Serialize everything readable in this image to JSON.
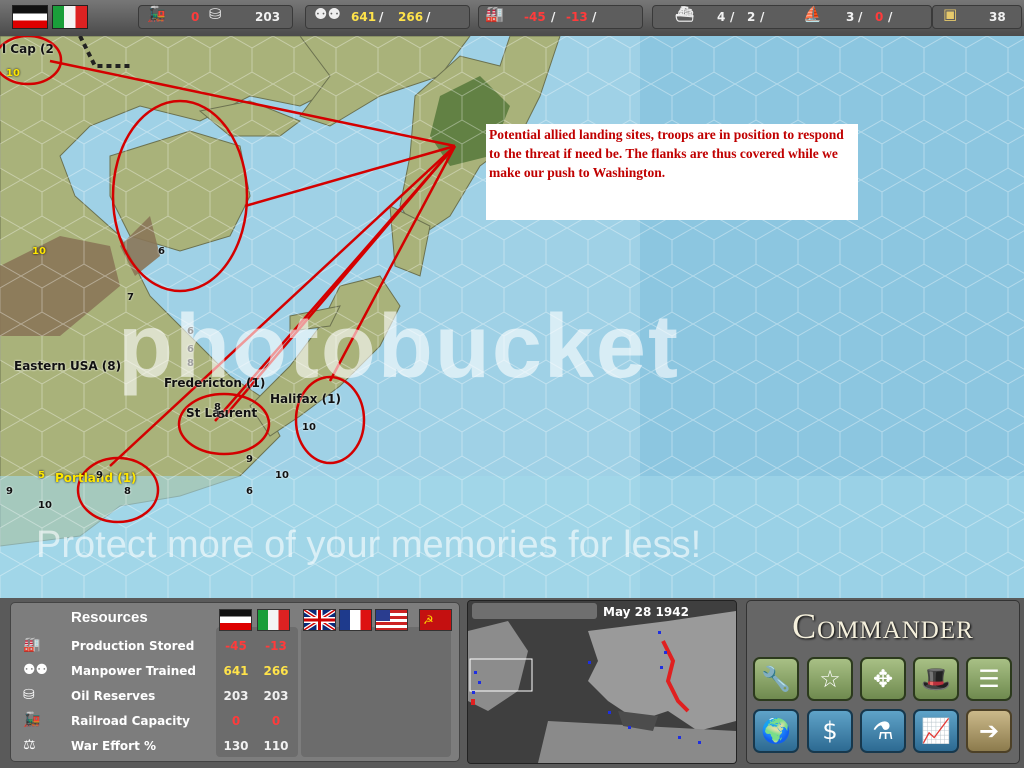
{
  "topbar": {
    "rail": "0",
    "oil": "203",
    "manpower_de": "641",
    "manpower_it": "266",
    "slash1": "/",
    "slash2": "/",
    "production_de": "-45",
    "production_it": "-13",
    "slash3": "/",
    "slash4": "/",
    "ships_de": "4",
    "ships_it": "2",
    "slash5": "/",
    "slash6": "/",
    "subs_de": "3",
    "subs_it": "0",
    "slash7": "/",
    "slash8": "/",
    "war_chest": "38"
  },
  "map": {
    "labels": {
      "cap": "l Cap (2",
      "eastern_usa": "Eastern USA (8)",
      "fredericton": "Fredericton (1)",
      "st_laurent": "St Laurent",
      "halifax": "Halifax (1)",
      "portland": "Portland (1)"
    },
    "units": {
      "u1": "6",
      "u2": "7",
      "u3": "6",
      "u4": "8",
      "u5": "6",
      "u6": "8",
      "u7": "5",
      "u8": "9",
      "u9": "10",
      "u10": "6",
      "u11": "10",
      "u12": "10",
      "u13": "5",
      "u14": "10",
      "u15": "9",
      "u16": "9",
      "u17": "8",
      "u18": "10"
    },
    "annotation": "Potential allied landing sites, troops are in position to respond to the threat if need be. The flanks are thus covered while we make our push to Washington.",
    "watermark_logo": "photobucket",
    "watermark_slogan": "Protect more of your memories for less!"
  },
  "resources": {
    "title": "Resources",
    "rows": [
      {
        "label": "Production Stored",
        "de": "-45",
        "it": "-13"
      },
      {
        "label": "Manpower Trained",
        "de": "641",
        "it": "266"
      },
      {
        "label": "Oil Reserves",
        "de": "203",
        "it": "203"
      },
      {
        "label": "Railroad Capacity",
        "de": "0",
        "it": "0"
      },
      {
        "label": "War Effort %",
        "de": "130",
        "it": "110"
      }
    ]
  },
  "minimap": {
    "date": "May 28 1942"
  },
  "commander": {
    "title": "Commander"
  },
  "colors": {
    "value_red": "#ff3b3b",
    "value_yellow": "#ffe34a",
    "annotation_red": "#c00000",
    "land": "#a9b27a",
    "sea": "#9fd1e6"
  }
}
